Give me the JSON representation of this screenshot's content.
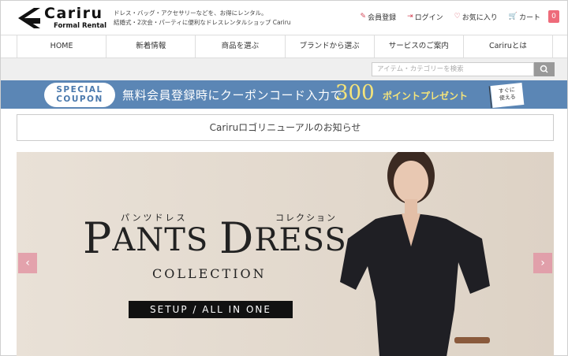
{
  "header": {
    "logo_name": "Cariru",
    "logo_sub": "Formal Rental",
    "tagline_line1": "ドレス・バッグ・アクセサリーなどを、お得にレンタル。",
    "tagline_line2": "結婚式・2次会・パーティに便利なドレスレンタルショップ Cariru",
    "links": {
      "register": "会員登録",
      "login": "ログイン",
      "favorites": "お気に入り",
      "cart": "カート",
      "cart_count": "0"
    }
  },
  "nav": {
    "items": [
      "HOME",
      "新着情報",
      "商品を選ぶ",
      "ブランドから選ぶ",
      "サービスのご案内",
      "Cariruとは"
    ]
  },
  "search": {
    "placeholder": "アイテム・カテゴリーを検索"
  },
  "coupon": {
    "pill_line1": "SPECIAL",
    "pill_line2": "COUPON",
    "text": "無料会員登録時にクーポンコード入力で",
    "number": "300",
    "after": "ポイントプレゼント",
    "badge_line1": "すぐに",
    "badge_line2": "使える"
  },
  "notice": {
    "text": "Cariruロゴリニューアルのお知らせ"
  },
  "hero": {
    "kana1": "パンツドレス",
    "kana2": "コレクション",
    "title_p": "P",
    "title_rest1": "ANTS ",
    "title_d": "D",
    "title_rest2": "RESS",
    "collection": "COLLECTION",
    "setup": "SETUP / ALL IN ONE",
    "prev": "‹",
    "next": "›"
  },
  "colors": {
    "accent_pink": "#ee6b7a",
    "coupon_blue": "#5b86b5",
    "coupon_yellow": "#f5e47a"
  }
}
